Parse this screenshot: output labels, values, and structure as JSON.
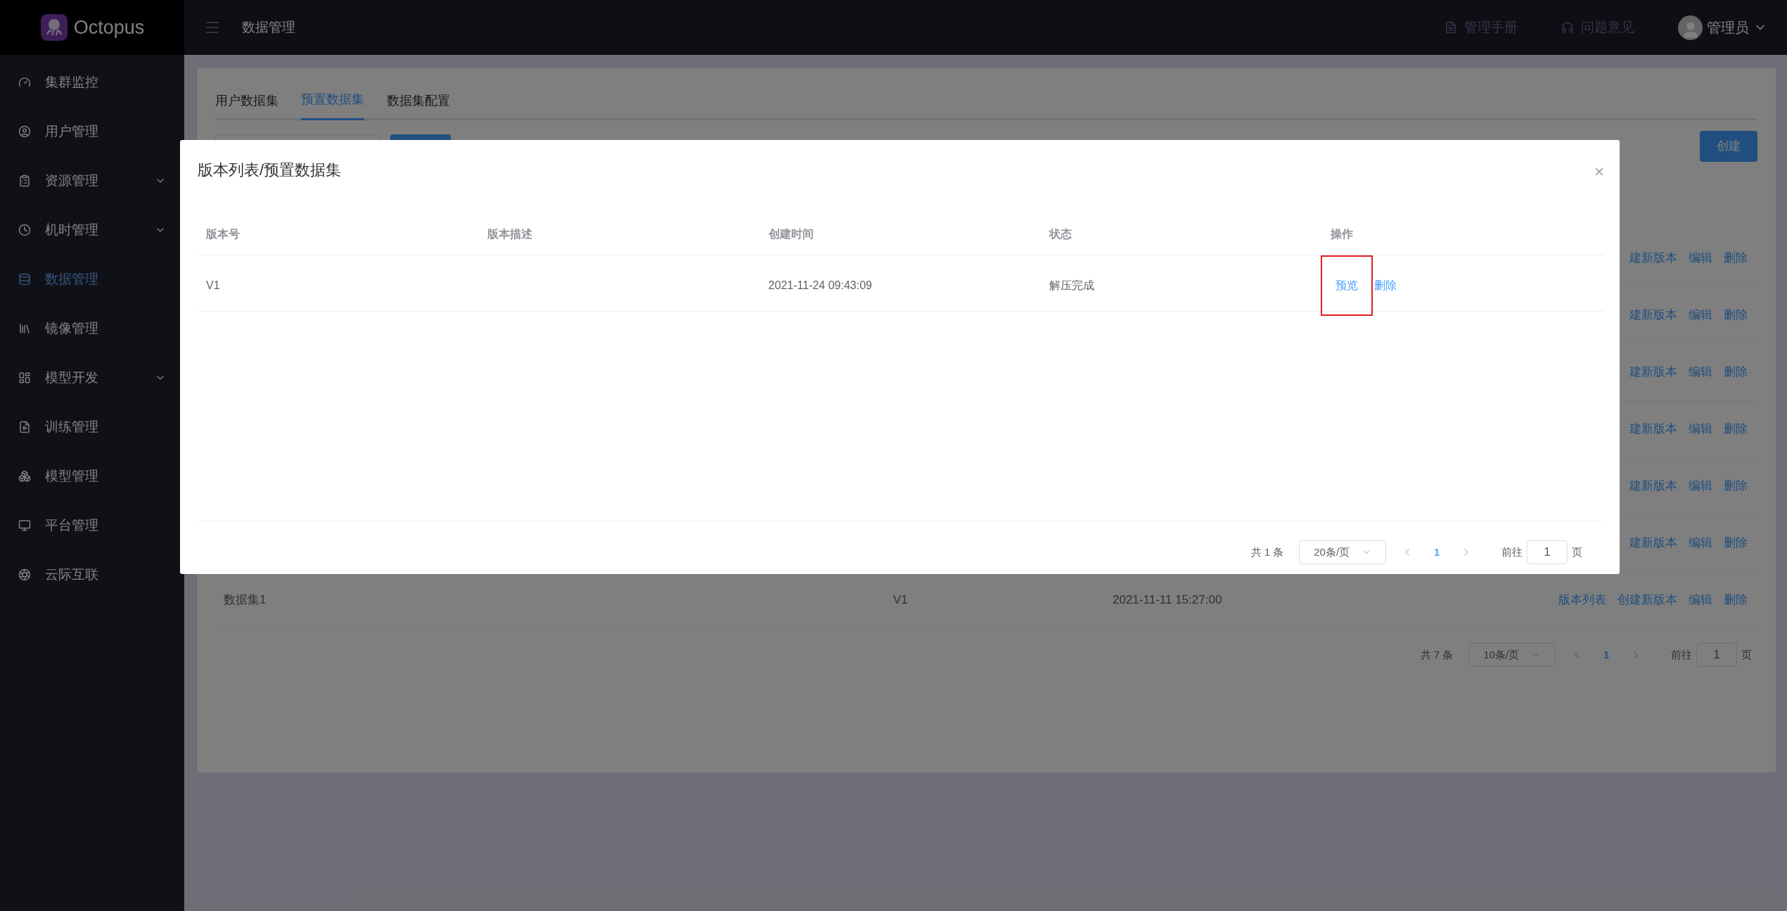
{
  "app": {
    "name": "Octopus"
  },
  "header": {
    "title": "数据管理",
    "links": [
      {
        "label": "管理手册"
      },
      {
        "label": "问题意见"
      }
    ],
    "user": "管理员"
  },
  "sidebar": {
    "items": [
      {
        "label": "集群监控",
        "selected": false,
        "submenu": false
      },
      {
        "label": "用户管理",
        "selected": false,
        "submenu": false
      },
      {
        "label": "资源管理",
        "selected": false,
        "submenu": true
      },
      {
        "label": "机时管理",
        "selected": false,
        "submenu": true
      },
      {
        "label": "数据管理",
        "selected": true,
        "submenu": false
      },
      {
        "label": "镜像管理",
        "selected": false,
        "submenu": false
      },
      {
        "label": "模型开发",
        "selected": false,
        "submenu": true
      },
      {
        "label": "训练管理",
        "selected": false,
        "submenu": false
      },
      {
        "label": "模型管理",
        "selected": false,
        "submenu": false
      },
      {
        "label": "平台管理",
        "selected": false,
        "submenu": false
      },
      {
        "label": "云际互联",
        "selected": false,
        "submenu": false
      }
    ]
  },
  "page": {
    "tabs": [
      {
        "label": "用户数据集",
        "selected": false
      },
      {
        "label": "预置数据集",
        "selected": true
      },
      {
        "label": "数据集配置",
        "selected": false
      }
    ],
    "create_button": "创建",
    "rows": [
      {
        "actions": [
          "建新版本",
          "编辑",
          "删除"
        ]
      },
      {
        "actions": [
          "建新版本",
          "编辑",
          "删除"
        ]
      },
      {
        "actions": [
          "建新版本",
          "编辑",
          "删除"
        ]
      },
      {
        "actions": [
          "建新版本",
          "编辑",
          "删除"
        ]
      },
      {
        "actions": [
          "建新版本",
          "编辑",
          "删除"
        ]
      },
      {
        "actions": [
          "建新版本",
          "编辑",
          "删除"
        ]
      },
      {
        "name": "数据集1",
        "version": "V1",
        "created": "2021-11-11 15:27:00",
        "actions": [
          "版本列表",
          "创建新版本",
          "编辑",
          "删除"
        ]
      }
    ],
    "pagination": {
      "total": "共 7 条",
      "page_size": "10条/页",
      "pages": [
        {
          "label": "1",
          "selected": true
        }
      ],
      "goto_label": "前往",
      "goto_value": "1",
      "goto_unit": "页"
    }
  },
  "modal": {
    "title": "版本列表/预置数据集",
    "columns": [
      "版本号",
      "版本描述",
      "创建时间",
      "状态",
      "操作"
    ],
    "rows": [
      {
        "version": "V1",
        "created": "2021-11-24 09:43:09",
        "status": "解压完成",
        "actions": [
          {
            "label": "预览",
            "highlighted": true
          },
          {
            "label": "删除",
            "highlighted": false
          }
        ]
      }
    ],
    "pagination": {
      "total": "共 1 条",
      "page_size": "20条/页",
      "pages": [
        {
          "label": "1",
          "selected": true
        }
      ],
      "goto_label": "前往",
      "goto_value": "1",
      "goto_unit": "页"
    }
  }
}
